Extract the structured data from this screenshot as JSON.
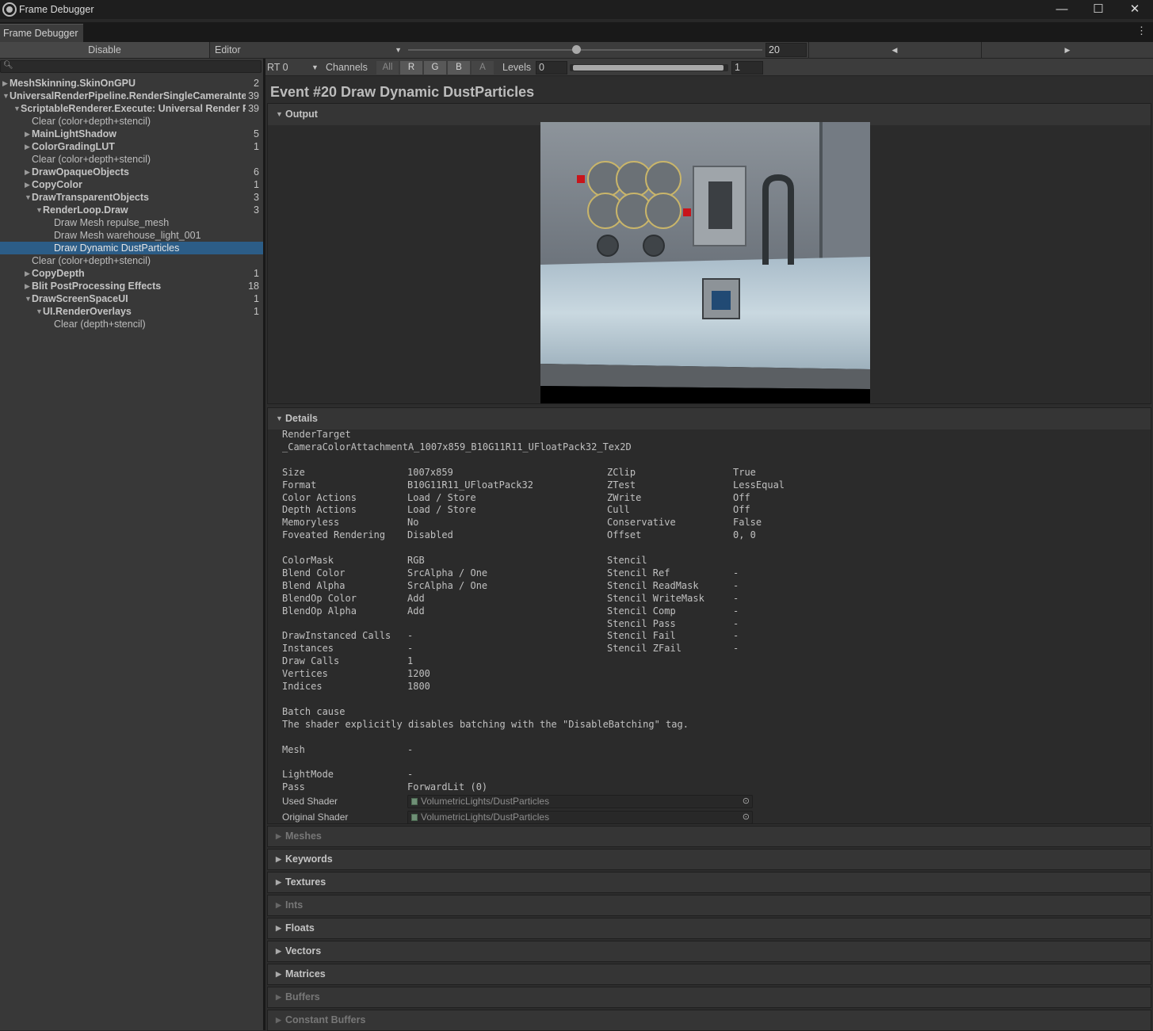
{
  "window": {
    "title": "Frame Debugger",
    "minimize": "—",
    "maximize": "☐",
    "close": "✕"
  },
  "tab": {
    "label": "Frame Debugger",
    "more": "⋮"
  },
  "toolbar": {
    "disable_label": "Disable",
    "target_label": "Editor",
    "event_index": "20",
    "prev_arrow": "◀",
    "next_arrow": "▶"
  },
  "rt_bar": {
    "rt_label": "RT 0",
    "channels_label": "Channels",
    "channels": [
      "All",
      "R",
      "G",
      "B",
      "A"
    ],
    "levels_label": "Levels",
    "levels_min": "0",
    "levels_max": "1"
  },
  "tree": [
    {
      "label": "MeshSkinning.SkinOnGPU",
      "count": "2",
      "depth": 0,
      "toggle": "▶",
      "bold": true
    },
    {
      "label": "UniversalRenderPipeline.RenderSingleCameraInter",
      "count": "39",
      "depth": 0,
      "toggle": "▼",
      "bold": true
    },
    {
      "label": "ScriptableRenderer.Execute: Universal Render Pi",
      "count": "39",
      "depth": 1,
      "toggle": "▼",
      "bold": true
    },
    {
      "label": "Clear (color+depth+stencil)",
      "count": "",
      "depth": 2,
      "toggle": "",
      "bold": false
    },
    {
      "label": "MainLightShadow",
      "count": "5",
      "depth": 2,
      "toggle": "▶",
      "bold": true
    },
    {
      "label": "ColorGradingLUT",
      "count": "1",
      "depth": 2,
      "toggle": "▶",
      "bold": true
    },
    {
      "label": "Clear (color+depth+stencil)",
      "count": "",
      "depth": 2,
      "toggle": "",
      "bold": false
    },
    {
      "label": "DrawOpaqueObjects",
      "count": "6",
      "depth": 2,
      "toggle": "▶",
      "bold": true
    },
    {
      "label": "CopyColor",
      "count": "1",
      "depth": 2,
      "toggle": "▶",
      "bold": true
    },
    {
      "label": "DrawTransparentObjects",
      "count": "3",
      "depth": 2,
      "toggle": "▼",
      "bold": true
    },
    {
      "label": "RenderLoop.Draw",
      "count": "3",
      "depth": 3,
      "toggle": "▼",
      "bold": true
    },
    {
      "label": "Draw Mesh repulse_mesh",
      "count": "",
      "depth": 4,
      "toggle": "",
      "bold": false
    },
    {
      "label": "Draw Mesh warehouse_light_001",
      "count": "",
      "depth": 4,
      "toggle": "",
      "bold": false
    },
    {
      "label": "Draw Dynamic DustParticles",
      "count": "",
      "depth": 4,
      "toggle": "",
      "bold": false,
      "selected": true
    },
    {
      "label": "Clear (color+depth+stencil)",
      "count": "",
      "depth": 2,
      "toggle": "",
      "bold": false
    },
    {
      "label": "CopyDepth",
      "count": "1",
      "depth": 2,
      "toggle": "▶",
      "bold": true
    },
    {
      "label": "Blit PostProcessing Effects",
      "count": "18",
      "depth": 2,
      "toggle": "▶",
      "bold": true
    },
    {
      "label": "DrawScreenSpaceUI",
      "count": "1",
      "depth": 2,
      "toggle": "▼",
      "bold": true
    },
    {
      "label": "UI.RenderOverlays",
      "count": "1",
      "depth": 3,
      "toggle": "▼",
      "bold": true
    },
    {
      "label": "Clear (depth+stencil)",
      "count": "",
      "depth": 4,
      "toggle": "",
      "bold": false
    }
  ],
  "event": {
    "title": "Event #20 Draw Dynamic DustParticles"
  },
  "output": {
    "header": "Output"
  },
  "details": {
    "header": "Details",
    "render_target_label": "RenderTarget",
    "render_target_value": "_CameraColorAttachmentA_1007x859_B10G11R11_UFloatPack32_Tex2D",
    "left_groups": [
      [
        [
          "Size",
          "1007x859"
        ],
        [
          "Format",
          "B10G11R11_UFloatPack32"
        ],
        [
          "Color Actions",
          "Load / Store"
        ],
        [
          "Depth Actions",
          "Load / Store"
        ],
        [
          "Memoryless",
          "No"
        ],
        [
          "Foveated Rendering",
          "Disabled"
        ]
      ],
      [
        [
          "ColorMask",
          "RGB"
        ],
        [
          "Blend Color",
          "SrcAlpha / One"
        ],
        [
          "Blend Alpha",
          "SrcAlpha / One"
        ],
        [
          "BlendOp Color",
          "Add"
        ],
        [
          "BlendOp Alpha",
          "Add"
        ]
      ],
      [
        [
          "DrawInstanced Calls",
          "-"
        ],
        [
          "Instances",
          "-"
        ],
        [
          "Draw Calls",
          "1"
        ],
        [
          "Vertices",
          "1200"
        ],
        [
          "Indices",
          "1800"
        ]
      ]
    ],
    "right_groups": [
      [
        [
          "ZClip",
          "True"
        ],
        [
          "ZTest",
          "LessEqual"
        ],
        [
          "ZWrite",
          "Off"
        ],
        [
          "Cull",
          "Off"
        ],
        [
          "Conservative",
          "False"
        ],
        [
          "Offset",
          "0, 0"
        ]
      ],
      [
        [
          "Stencil",
          ""
        ],
        [
          "Stencil Ref",
          "-"
        ],
        [
          "Stencil ReadMask",
          "-"
        ],
        [
          "Stencil WriteMask",
          "-"
        ],
        [
          "Stencil Comp",
          "-"
        ],
        [
          "Stencil Pass",
          "-"
        ],
        [
          "Stencil Fail",
          "-"
        ],
        [
          "Stencil ZFail",
          "-"
        ]
      ]
    ],
    "batch_cause_label": "Batch cause",
    "batch_cause_value": "The shader explicitly disables batching with the \"DisableBatching\" tag.",
    "mesh_label": "Mesh",
    "mesh_value": "-",
    "lightmode_label": "LightMode",
    "lightmode_value": "-",
    "pass_label": "Pass",
    "pass_value": "ForwardLit (0)",
    "used_shader_label": "Used Shader",
    "used_shader_value": "VolumetricLights/DustParticles",
    "original_shader_label": "Original Shader",
    "original_shader_value": "VolumetricLights/DustParticles"
  },
  "sections": [
    {
      "label": "Meshes",
      "enabled": false
    },
    {
      "label": "Keywords",
      "enabled": true
    },
    {
      "label": "Textures",
      "enabled": true
    },
    {
      "label": "Ints",
      "enabled": false
    },
    {
      "label": "Floats",
      "enabled": true
    },
    {
      "label": "Vectors",
      "enabled": true
    },
    {
      "label": "Matrices",
      "enabled": true
    },
    {
      "label": "Buffers",
      "enabled": false
    },
    {
      "label": "Constant Buffers",
      "enabled": false
    }
  ]
}
